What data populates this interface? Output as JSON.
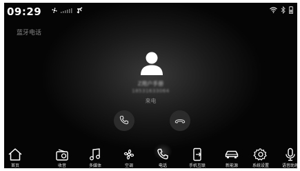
{
  "status_bar": {
    "time": "09:29",
    "icons": [
      "fan-icon",
      "signal-icon",
      "usb-icon",
      "wifi-icon",
      "bluetooth-icon",
      "battery-icon"
    ]
  },
  "app": {
    "title": "蓝牙电话"
  },
  "call": {
    "caller_name": "Z用户手册",
    "caller_number": "18531633064",
    "status": "来电",
    "buttons": [
      "answer-call",
      "decline-call"
    ]
  },
  "dock": {
    "items": [
      {
        "label": "首页",
        "icon": "home-icon"
      },
      {
        "label": "收音",
        "icon": "radio-icon"
      },
      {
        "label": "多媒体",
        "icon": "music-icon"
      },
      {
        "label": "空调",
        "icon": "fan-icon"
      },
      {
        "label": "电话",
        "icon": "phone-icon"
      },
      {
        "label": "手机互联",
        "icon": "phone-link-icon"
      },
      {
        "label": "新能源",
        "icon": "car-icon"
      },
      {
        "label": "系统设置",
        "icon": "gear-icon"
      },
      {
        "label": "语音助理",
        "icon": "microphone-icon"
      }
    ],
    "active": "电话"
  },
  "colors": {
    "background": "#050505",
    "text": "#ffffff",
    "muted": "#8a8a8a"
  }
}
